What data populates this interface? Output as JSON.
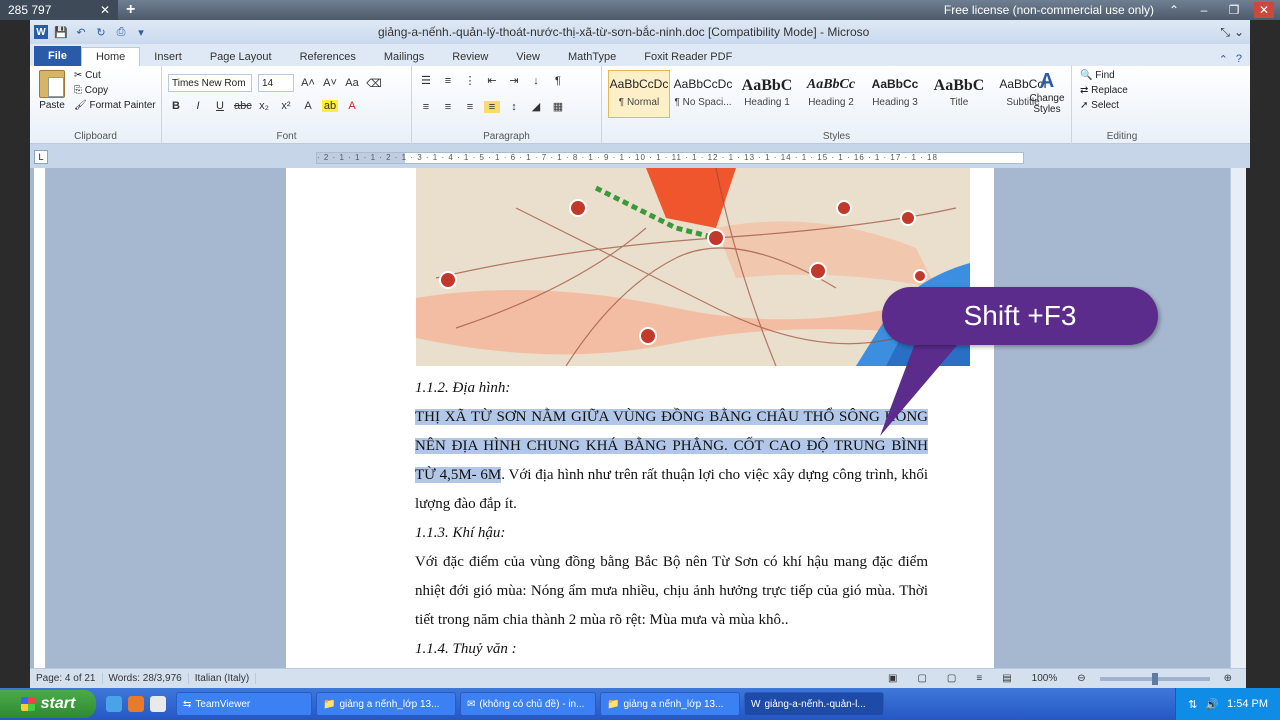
{
  "teamviewer": {
    "session_id": "285 797",
    "license_text": "Free license (non-commercial use only)"
  },
  "window": {
    "title": "giảng-a-nếnh.-quản-lý-thoát-nước-thị-xã-từ-sơn-bắc-ninh.doc [Compatibility Mode] - Microso"
  },
  "ribbon_tabs": [
    "File",
    "Home",
    "Insert",
    "Page Layout",
    "References",
    "Mailings",
    "Review",
    "View",
    "MathType",
    "Foxit Reader PDF"
  ],
  "clipboard": {
    "paste": "Paste",
    "cut": "Cut",
    "copy": "Copy",
    "format_painter": "Format Painter",
    "group_label": "Clipboard"
  },
  "font": {
    "font_name": "Times New Rom",
    "font_size": "14",
    "group_label": "Font"
  },
  "paragraph": {
    "group_label": "Paragraph"
  },
  "styles": {
    "tiles": [
      {
        "preview": "AaBbCcDc",
        "name": "¶ Normal"
      },
      {
        "preview": "AaBbCcDc",
        "name": "¶ No Spaci..."
      },
      {
        "preview": "AaBbC",
        "name": "Heading 1"
      },
      {
        "preview": "AaBbCc",
        "name": "Heading 2"
      },
      {
        "preview": "AaBbCc",
        "name": "Heading 3"
      },
      {
        "preview": "AaBbC",
        "name": "Title"
      },
      {
        "preview": "AaBbCcI",
        "name": "Subtitle"
      }
    ],
    "change_styles": "Change Styles",
    "group_label": "Styles"
  },
  "editing": {
    "find": "Find",
    "replace": "Replace",
    "select": "Select",
    "group_label": "Editing"
  },
  "ruler_text": "· 2 · 1 · 1 · 1 · 2 · 1 · 3 · 1 · 4 · 1 · 5 · 1 · 6 · 1 · 7 · 1 · 8 · 1 · 9 · 1 · 10 · 1 · 11 · 1 · 12 · 1 · 13 · 1 · 14 · 1 · 15 · 1 · 16 · 1 · 17 · 1 · 18",
  "document": {
    "heading_terrain": "1.1.2. Địa hình:",
    "terrain_selected": "THỊ XÃ TỪ SƠN NẰM GIỮA VÙNG ĐỒNG BẰNG CHÂU THỔ SÔNG HỒNG NÊN ĐỊA HÌNH CHUNG KHÁ BẰNG PHẲNG. CỐT CAO ĐỘ TRUNG BÌNH TỪ 4,5M- 6M",
    "terrain_rest": ". Với địa hình như trên  rất thuận lợi cho việc xây dựng công trình, khối lượng đào đắp ít.",
    "heading_climate": "1.1.3. Khí hậu:",
    "climate_text": "Với đặc điểm của vùng đồng bằng Bắc Bộ nên Từ Sơn có khí hậu mang đặc điểm nhiệt đới gió mùa: Nóng ẩm mưa nhiều, chịu ảnh hưởng trực tiếp của gió mùa. Thời tiết trong năm chia thành 2 mùa rõ rệt: Mùa mưa và mùa khô..",
    "heading_hydro": "1.1.4. Thuỷ văn :"
  },
  "callout": {
    "text": "Shift +F3"
  },
  "status_bar": {
    "page": "Page: 4 of 21",
    "words": "Words: 28/3,976",
    "language": "Italian (Italy)",
    "zoom": "100%"
  },
  "taskbar": {
    "start": "start",
    "tasks": [
      {
        "label": "TeamViewer"
      },
      {
        "label": "giảng a nếnh_lớp 13..."
      },
      {
        "label": "(không có chủ đề) - in..."
      },
      {
        "label": "giảng a nếnh_lớp 13..."
      },
      {
        "label": "giảng-a-nếnh.-quản-l..."
      }
    ],
    "clock": "1:54 PM"
  },
  "colors": {
    "callout": "#5b2c8c",
    "selection": "#b2c7e8",
    "taskbar": "#2457c5"
  }
}
